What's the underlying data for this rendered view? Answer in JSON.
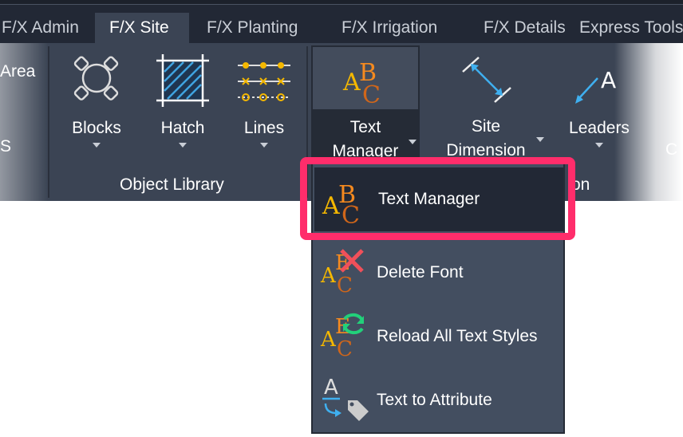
{
  "tabs": [
    {
      "label": "F/X Admin",
      "active": false
    },
    {
      "label": "F/X Site",
      "active": true
    },
    {
      "label": "F/X Planting",
      "active": false
    },
    {
      "label": "F/X Irrigation",
      "active": false
    },
    {
      "label": "F/X Details",
      "active": false
    },
    {
      "label": "Express Tools",
      "active": false
    }
  ],
  "ribbon": {
    "left_partial": {
      "area": "Area",
      "s": "S"
    },
    "tools": {
      "blocks": "Blocks",
      "hatch": "Hatch",
      "lines": "Lines",
      "text_manager_line1": "Text",
      "text_manager_line2": "Manager",
      "site_dimension_line1": "Site",
      "site_dimension_line2": "Dimension",
      "leaders": "Leaders",
      "right_partial": "C"
    },
    "panels": {
      "object_library": "Object Library",
      "annotation_partial": "on"
    }
  },
  "menu": {
    "items": [
      {
        "label": "Text Manager",
        "icon": "abc-text-icon",
        "highlighted": true
      },
      {
        "label": "Delete Font",
        "icon": "abc-delete-icon"
      },
      {
        "label": "Reload All Text Styles",
        "icon": "abc-reload-icon"
      },
      {
        "label": "Text to Attribute",
        "icon": "text-to-attribute-icon"
      }
    ]
  },
  "colors": {
    "highlight": "#ff2d6b",
    "ribbon": "#3b4454",
    "tabbar": "#222835",
    "menu": "#434e60"
  }
}
